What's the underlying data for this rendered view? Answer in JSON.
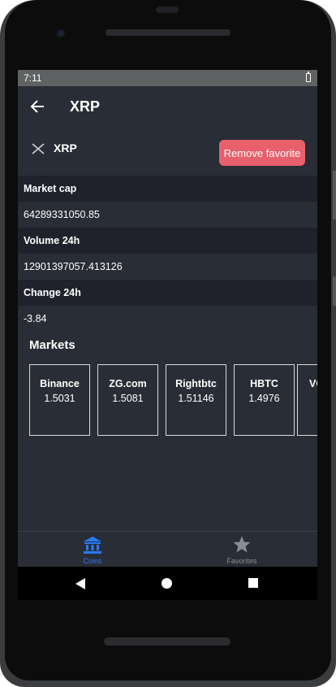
{
  "status_bar": {
    "time": "7:11"
  },
  "app_bar": {
    "title": "XRP"
  },
  "coin": {
    "symbol": "XRP",
    "remove_favorite_label": "Remove favorite"
  },
  "stats": [
    {
      "label": "Market cap",
      "value": "64289331050.85"
    },
    {
      "label": "Volume 24h",
      "value": "12901397057.413126"
    },
    {
      "label": "Change 24h",
      "value": "-3.84"
    }
  ],
  "markets": {
    "title": "Markets",
    "items": [
      {
        "name": "Binance",
        "price": "1.5031"
      },
      {
        "name": "ZG.com",
        "price": "1.5081"
      },
      {
        "name": "Rightbtc",
        "price": "1.51146"
      },
      {
        "name": "HBTC",
        "price": "1.4976"
      },
      {
        "name": "VC",
        "price": ""
      }
    ]
  },
  "bottom_nav": {
    "items": [
      {
        "label": "Coins",
        "icon": "bank-icon",
        "active": true
      },
      {
        "label": "Favorites",
        "icon": "star-icon",
        "active": false
      }
    ]
  },
  "colors": {
    "background": "#292d35",
    "label_row": "#1f222a",
    "accent_active": "#2979ff",
    "inactive": "#8a8d93",
    "remove_button": "#e8606c"
  }
}
